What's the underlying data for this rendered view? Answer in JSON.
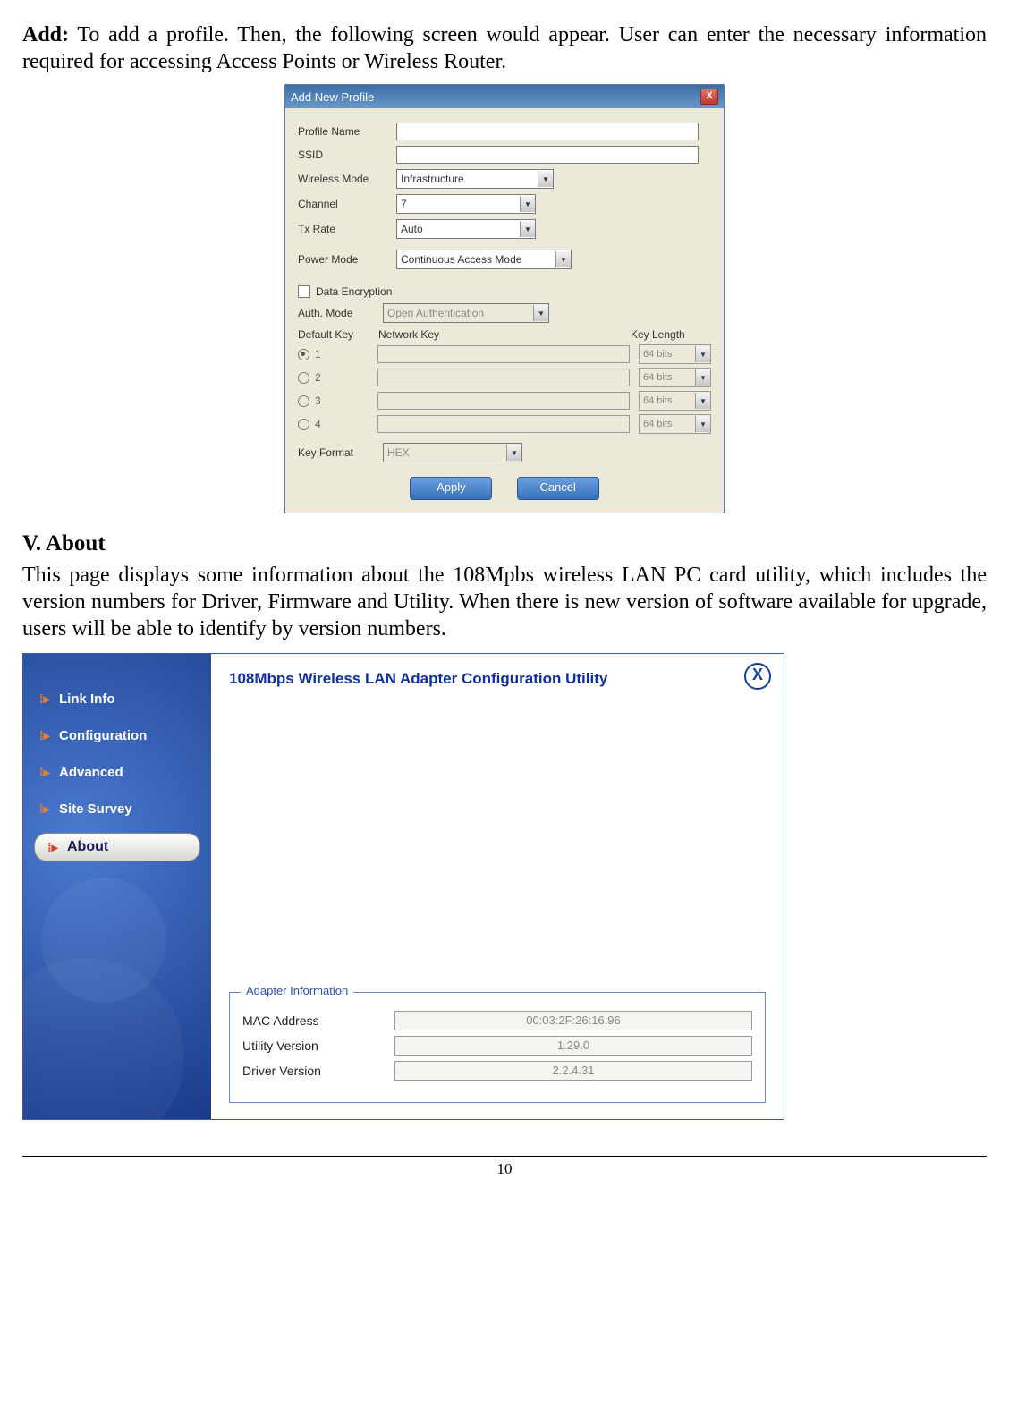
{
  "intro": {
    "add_label": "Add:",
    "add_text": " To add a profile. Then, the following screen would appear. User can enter the necessary information required for accessing Access Points or Wireless Router."
  },
  "dialog": {
    "title": "Add New Profile",
    "labels": {
      "profile_name": "Profile Name",
      "ssid": "SSID",
      "wireless_mode": "Wireless Mode",
      "channel": "Channel",
      "tx_rate": "Tx Rate",
      "power_mode": "Power Mode",
      "data_encryption": "Data Encryption",
      "auth_mode": "Auth. Mode",
      "default_key": "Default Key",
      "network_key": "Network Key",
      "key_length": "Key Length",
      "key_format": "Key Format"
    },
    "values": {
      "wireless_mode": "Infrastructure",
      "channel": "7",
      "tx_rate": "Auto",
      "power_mode": "Continuous Access Mode",
      "auth_mode": "Open Authentication",
      "key_format": "HEX",
      "key_length_option": "64 bits"
    },
    "keys": [
      "1",
      "2",
      "3",
      "4"
    ],
    "buttons": {
      "apply": "Apply",
      "cancel": "Cancel"
    }
  },
  "section_about": {
    "heading": "V. About",
    "text": "This page displays some information about the 108Mpbs wireless LAN PC card utility, which includes the version numbers for Driver, Firmware and Utility.  When there is new version of software available for upgrade, users will be able to identify by version numbers."
  },
  "util": {
    "title": "108Mbps Wireless LAN Adapter Configuration Utility",
    "nav": [
      "Link Info",
      "Configuration",
      "Advanced",
      "Site Survey",
      "About"
    ],
    "active_nav": "About",
    "fieldset_legend": "Adapter Information",
    "info": {
      "mac_label": "MAC Address",
      "mac_value": "00:03:2F:26:16:96",
      "utility_label": "Utility Version",
      "utility_value": "1.29.0",
      "driver_label": "Driver Version",
      "driver_value": "2.2.4.31"
    }
  },
  "page_number": "10"
}
